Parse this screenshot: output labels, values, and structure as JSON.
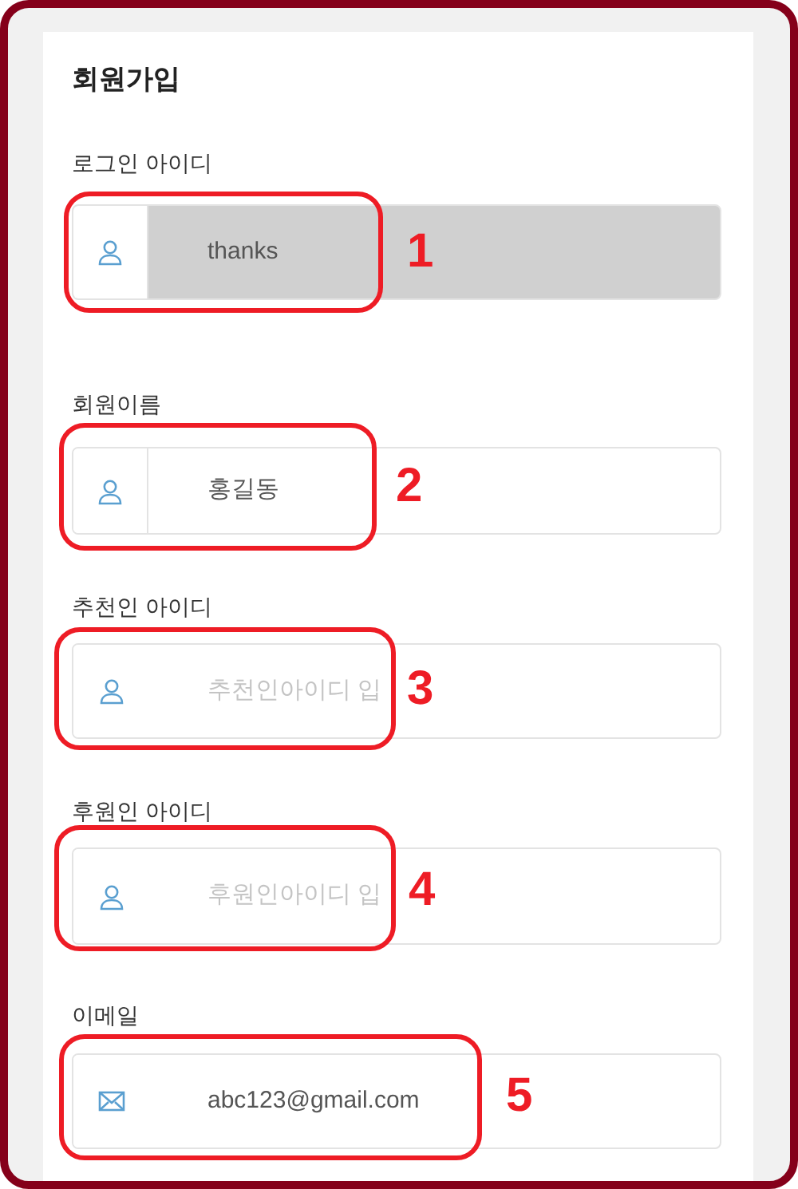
{
  "title": "회원가입",
  "fields": [
    {
      "label": "로그인 아이디",
      "kind": "person",
      "value": "thanks",
      "disabled": true,
      "divided": true,
      "annotation": "1"
    },
    {
      "label": "회원이름",
      "kind": "person",
      "value": "홍길동",
      "disabled": false,
      "divided": true,
      "annotation": "2"
    },
    {
      "label": "추천인 아이디",
      "kind": "person",
      "placeholder": "추천인아이디 입",
      "disabled": false,
      "divided": false,
      "annotation": "3"
    },
    {
      "label": "후원인 아이디",
      "kind": "person",
      "placeholder": "후원인아이디 입",
      "disabled": false,
      "divided": false,
      "annotation": "4"
    },
    {
      "label": "이메일",
      "kind": "mail",
      "value": "abc123@gmail.com",
      "disabled": false,
      "divided": false,
      "annotation": "5"
    }
  ]
}
